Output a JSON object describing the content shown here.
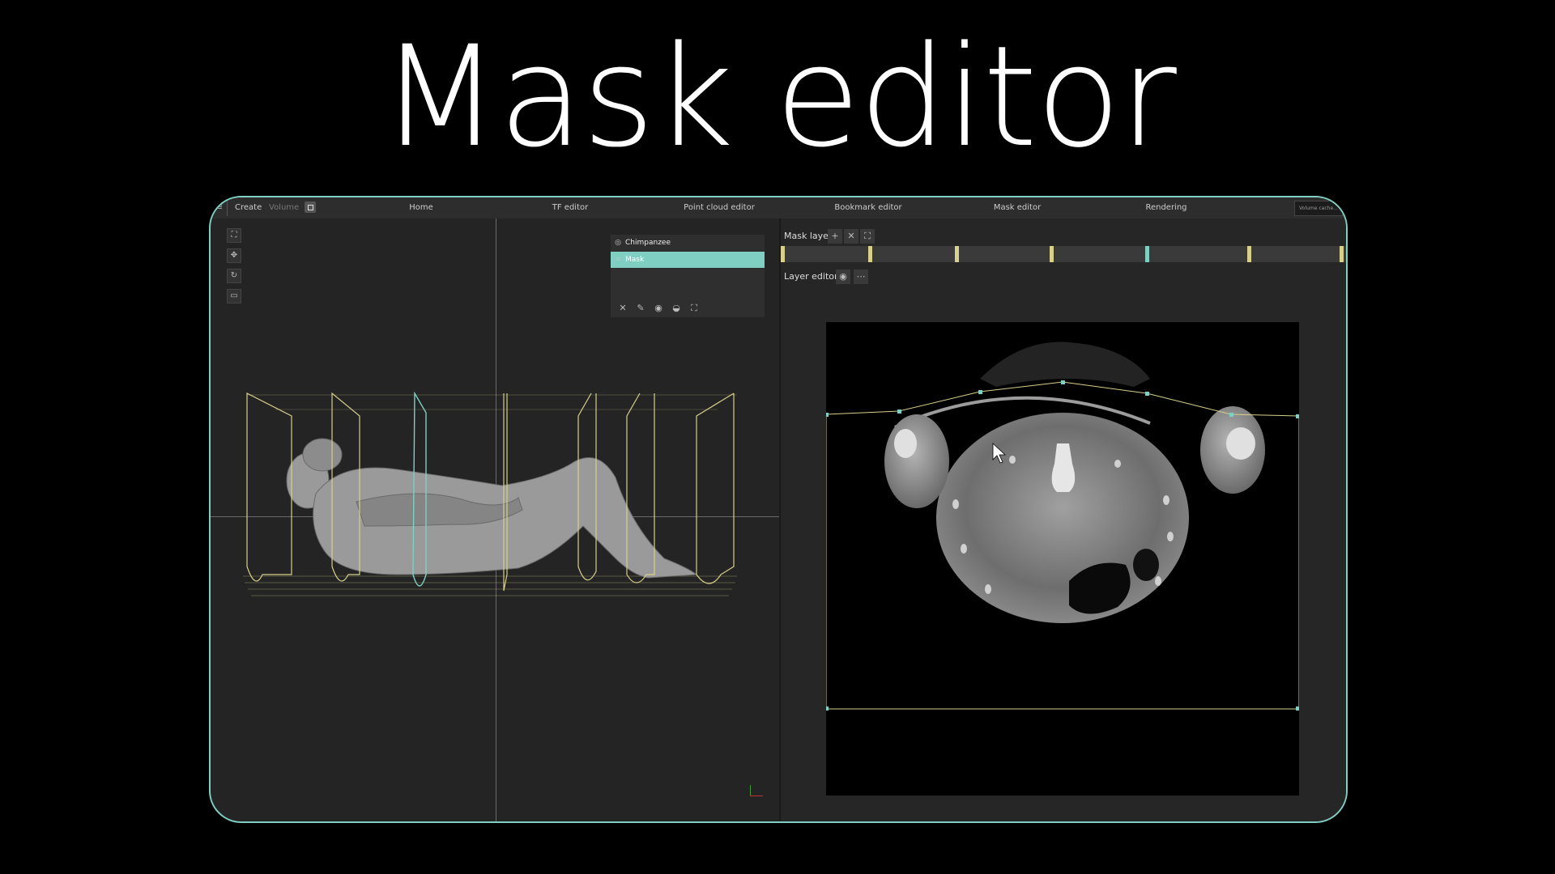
{
  "slide": {
    "title": "Mask editor"
  },
  "topbar": {
    "menu_icon": "menu-icon",
    "create_label": "Create",
    "volume_label": "Volume",
    "tabs": [
      {
        "label": "Home"
      },
      {
        "label": "TF editor"
      },
      {
        "label": "Point cloud editor"
      },
      {
        "label": "Bookmark editor"
      },
      {
        "label": "Mask editor",
        "active": true
      },
      {
        "label": "Rendering"
      }
    ],
    "cache_label": "Volume cache..."
  },
  "left_toolbar": [
    "fit-view-icon",
    "pan-icon",
    "rotate-icon",
    "screenshot-icon"
  ],
  "tree": {
    "items": [
      {
        "label": "Chimpanzee",
        "icon": "volume-icon"
      },
      {
        "label": "Mask",
        "icon": "crop-icon",
        "selected": true
      }
    ],
    "tools": [
      "close-icon",
      "pencil-icon",
      "eye-icon",
      "drop-icon",
      "fit-icon"
    ]
  },
  "mask_layers": {
    "label": "Mask layers",
    "buttons": [
      "add-icon",
      "close-icon",
      "fit-icon"
    ],
    "markers": 8,
    "active_marker": 5
  },
  "layer_editor": {
    "label": "Layer editor",
    "buttons": [
      "eye-icon",
      "more-icon"
    ]
  },
  "colors": {
    "accent": "#7fcfc3",
    "outline": "#d8cf8a",
    "background": "#242424"
  }
}
